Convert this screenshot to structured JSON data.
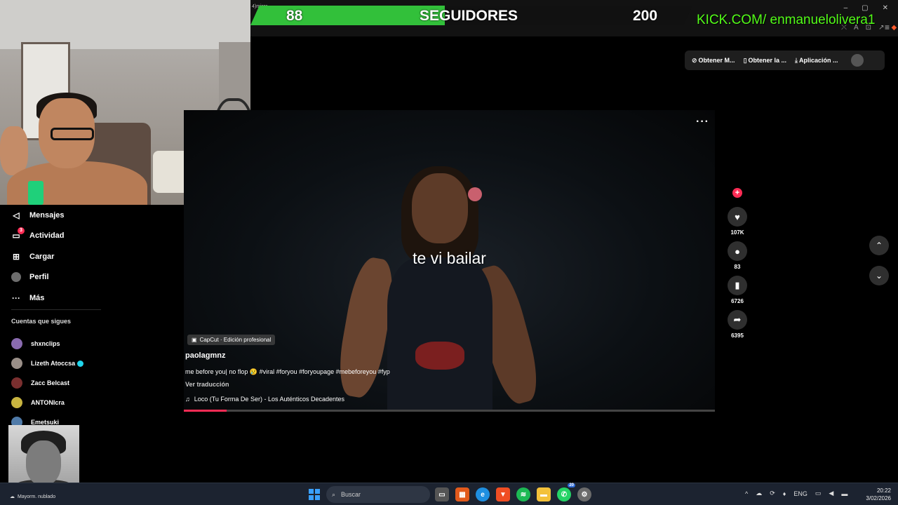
{
  "stream_overlay": {
    "follower_count": "88",
    "follower_goal_label": "SEGUIDORES",
    "follower_goal": "200",
    "goal_progress_fraction": 0.44,
    "goal_color": "#32c03a",
    "channel_url": "KICK.COM/ enmanuelolivera1",
    "channel_url_color": "#53fc18"
  },
  "browser": {
    "tab_title_fragment": "4)mirar"
  },
  "sidebar": {
    "nav_items": [
      {
        "label": "Mensajes",
        "icon": "send-icon"
      },
      {
        "label": "Actividad",
        "icon": "activity-icon",
        "badge": "3"
      },
      {
        "label": "Cargar",
        "icon": "upload-plus-icon"
      },
      {
        "label": "Perfil",
        "icon": "profile-avatar-icon"
      },
      {
        "label": "Más",
        "icon": "more-dots-icon"
      }
    ],
    "following_title": "Cuentas que sigues",
    "following": [
      {
        "name": "shxnclips",
        "verified": false
      },
      {
        "name": "Lizeth Atoccsa",
        "verified": true
      },
      {
        "name": "Zacc Belcast",
        "verified": false
      },
      {
        "name": "ANTONIcra",
        "verified": false
      },
      {
        "name": "Emetsuki",
        "verified": false
      }
    ]
  },
  "top_actions": {
    "item1": "Obtener M...",
    "item2": "Obtener la ...",
    "item3": "Aplicación ..."
  },
  "video": {
    "caption": "te vi bailar",
    "capcut_label": "CapCut · Edición profesional",
    "author": "paolagmnz",
    "description": "me before you| no flop 😢 #viral #foryou #foryoupage #mebeforeyou #fyp",
    "translate_label": "Ver traducción",
    "music": "Loco (Tu Forma De Ser) - Los Auténticos Decadentes",
    "progress_fraction": 0.08,
    "accent_color": "#fe2c55"
  },
  "actions": {
    "likes": "107K",
    "comments": "83",
    "saves": "6726",
    "shares": "6395"
  },
  "taskbar": {
    "weather": "Mayorm. nublado",
    "search_placeholder": "Buscar",
    "whatsapp_badge": "20",
    "language": "ENG",
    "time": "20:22",
    "date": "3/02/2026"
  }
}
